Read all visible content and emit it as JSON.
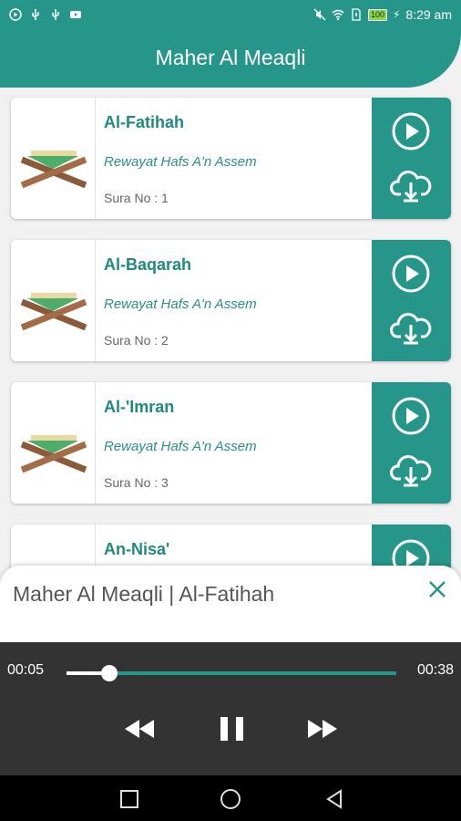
{
  "status_bar": {
    "time": "8:29 am",
    "battery": "100"
  },
  "header": {
    "title": "Maher Al Meaqli"
  },
  "suras": [
    {
      "name": "Al-Fatihah",
      "riwaya": "Rewayat Hafs A'n Assem",
      "number_label": "Sura No : 1"
    },
    {
      "name": "Al-Baqarah",
      "riwaya": "Rewayat Hafs A'n Assem",
      "number_label": "Sura No : 2"
    },
    {
      "name": "Al-'Imran",
      "riwaya": "Rewayat Hafs A'n Assem",
      "number_label": "Sura No : 3"
    },
    {
      "name": "An-Nisa'",
      "riwaya": "",
      "number_label": ""
    }
  ],
  "player": {
    "title": "Maher Al Meaqli | Al-Fatihah",
    "elapsed": "00:05",
    "total": "00:38",
    "progress": 0.13
  },
  "colors": {
    "accent": "#26968a",
    "player_bg": "#333333"
  }
}
